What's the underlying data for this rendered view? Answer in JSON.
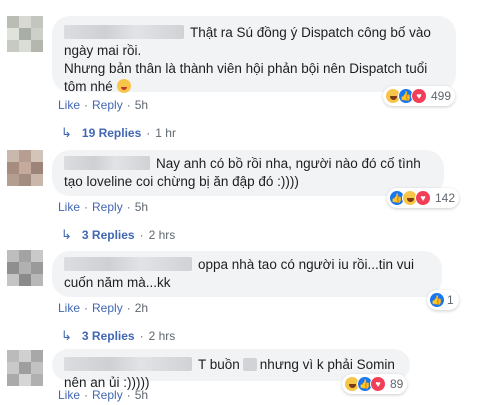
{
  "comments": [
    {
      "text_after_name": "Thật ra Sú đồng ý Dispatch công bố vào ngày mai rồi.",
      "text_line2": "Nhưng bản thân là thành viên hội phản bội nên Dispatch tuổi tôm nhé",
      "reaction_count": "499",
      "like": "Like",
      "reply": "Reply",
      "time": "5h",
      "replies_label": "19 Replies",
      "replies_time": "1 hr"
    },
    {
      "text": "Nay anh có bồ rồi nha, người nào đó cố tình tạo loveline coi chừng bị ăn đập đó :))))",
      "reaction_count": "142",
      "like": "Like",
      "reply": "Reply",
      "time": "5h",
      "replies_label": "3 Replies",
      "replies_time": "2 hrs"
    },
    {
      "text": "oppa nhà tao có người iu rồi...tin vui cuốn năm mà...kk",
      "reaction_count": "1",
      "like": "Like",
      "reply": "Reply",
      "time": "2h",
      "replies_label": "3 Replies",
      "replies_time": "2 hrs"
    },
    {
      "text_a": "T buồn",
      "text_b": "nhưng vì k phải Somin nên an ủi :)))))",
      "reaction_count": "89",
      "like": "Like",
      "reply": "Reply",
      "time": "5h"
    }
  ],
  "separator": "·",
  "icons": [
    "avatar",
    "haha-icon",
    "love-icon",
    "like-icon",
    "reply-arrow-icon"
  ]
}
